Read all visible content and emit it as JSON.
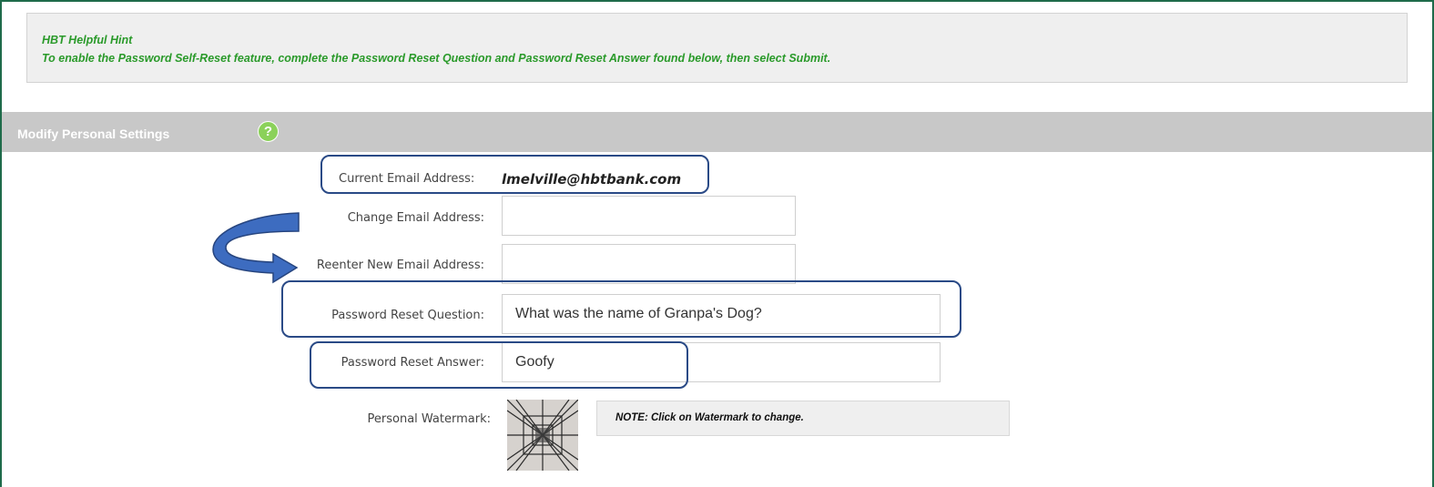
{
  "hint": {
    "title": "HBT Helpful Hint",
    "text": "To enable the Password Self-Reset feature, complete the Password Reset Question and Password Reset Answer found below, then select Submit."
  },
  "section": {
    "title": "Modify Personal Settings",
    "help_glyph": "?"
  },
  "form": {
    "current_email_label": "Current Email Address:",
    "current_email_value": "lmelville@hbtbank.com",
    "change_email_label": "Change Email Address:",
    "change_email_value": "",
    "reenter_email_label": "Reenter New Email Address:",
    "reenter_email_value": "",
    "reset_question_label": "Password Reset Question:",
    "reset_question_value": "What was the name of Granpa's Dog?",
    "reset_answer_label": "Password Reset Answer:",
    "reset_answer_value": "Goofy",
    "watermark_label": "Personal Watermark:",
    "watermark_note": "NOTE: Click on Watermark to change."
  },
  "colors": {
    "hint_text": "#2a9a2a",
    "callout_border": "#2a4a86",
    "arrow_fill": "#3d6cc0",
    "section_bar": "#c8c8c8",
    "help_icon": "#8bd15a"
  },
  "icons": {
    "help": "help-question-icon",
    "annotation_arrow": "curved-arrow-icon"
  }
}
